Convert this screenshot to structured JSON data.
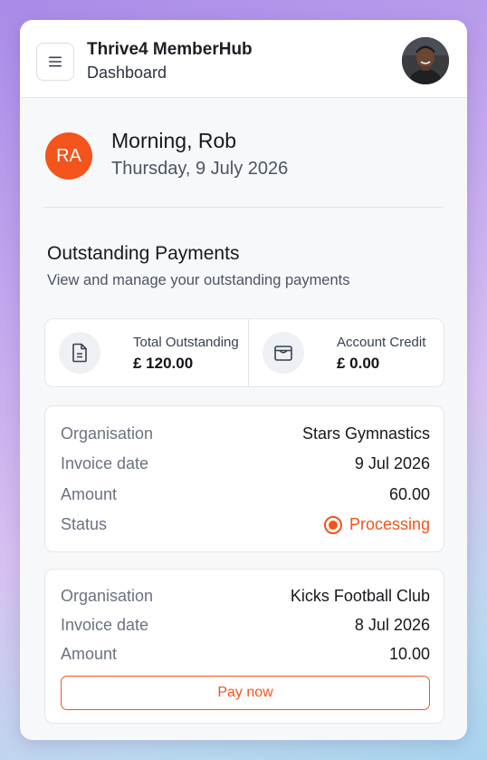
{
  "header": {
    "title": "Thrive4 MemberHub",
    "subtitle": "Dashboard"
  },
  "greeting": {
    "initials": "RA",
    "message": "Morning, Rob",
    "date": "Thursday, 9 July 2026"
  },
  "section": {
    "title": "Outstanding Payments",
    "subtitle": "View and manage your outstanding payments"
  },
  "summary": {
    "total_label": "Total Outstanding",
    "total_value": "£ 120.00",
    "credit_label": "Account Credit",
    "credit_value": "£ 0.00"
  },
  "invoices": [
    {
      "org_label": "Organisation",
      "org": "Stars Gymnastics",
      "date_label": "Invoice date",
      "date": "9 Jul 2026",
      "amount_label": "Amount",
      "amount": "60.00",
      "status_label": "Status",
      "status": "Processing"
    },
    {
      "org_label": "Organisation",
      "org": "Kicks Football Club",
      "date_label": "Invoice date",
      "date": "8 Jul 2026",
      "amount_label": "Amount",
      "amount": "10.00",
      "action": "Pay now"
    }
  ],
  "colors": {
    "accent": "#f2541b"
  }
}
